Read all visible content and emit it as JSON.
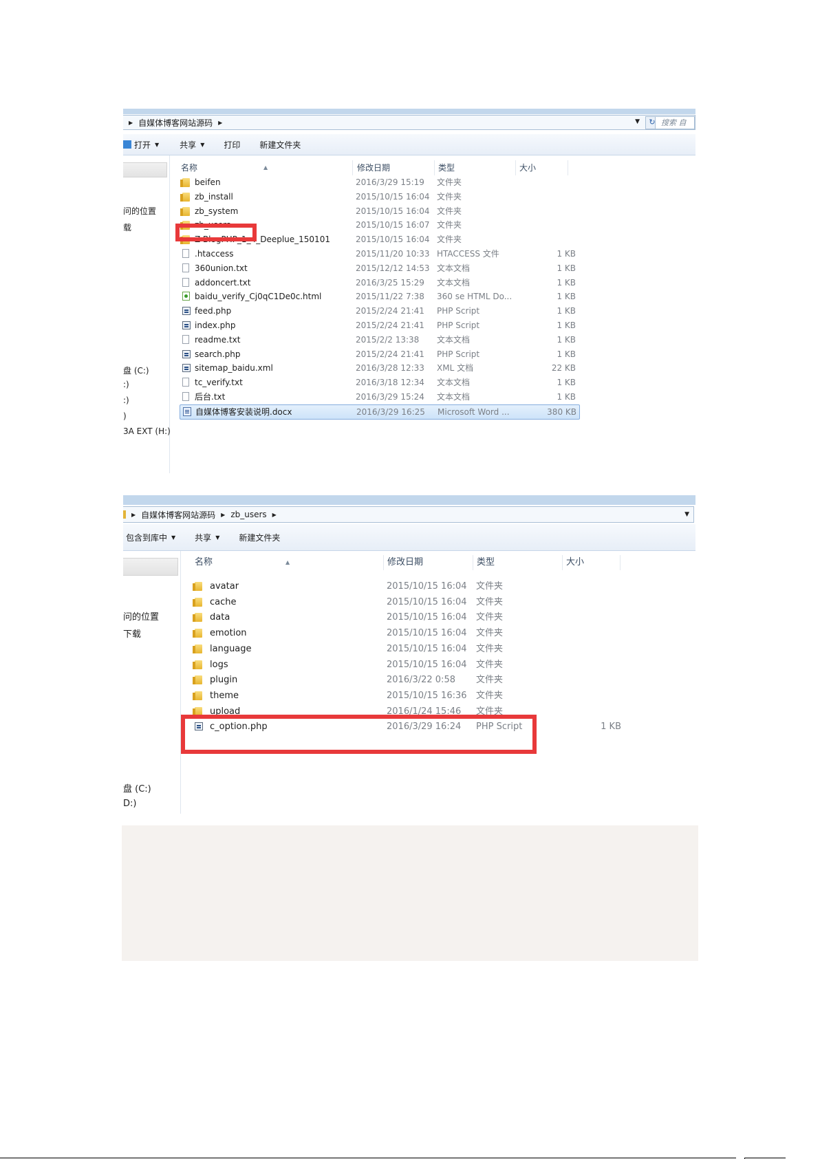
{
  "top": {
    "breadcrumb": "自媒体博客网站源码",
    "search_placeholder": "搜索 自",
    "toolbar": [
      "打开",
      "共享",
      "打印",
      "新建文件夹"
    ],
    "nav": [
      "问的位置",
      "载",
      "盘 (C:)",
      ":)",
      ":)",
      ")",
      "3A EXT (H:)"
    ],
    "columns": {
      "name": "名称",
      "date": "修改日期",
      "type": "类型",
      "size": "大小"
    },
    "files": [
      {
        "icon": "folder-icon",
        "name": "beifen",
        "date": "2016/3/29 15:19",
        "type": "文件夹",
        "size": ""
      },
      {
        "icon": "folder-icon",
        "name": "zb_install",
        "date": "2015/10/15 16:04",
        "type": "文件夹",
        "size": ""
      },
      {
        "icon": "folder-icon",
        "name": "zb_system",
        "date": "2015/10/15 16:04",
        "type": "文件夹",
        "size": ""
      },
      {
        "icon": "folder-icon",
        "name": "zb_users",
        "date": "2015/10/15 16:07",
        "type": "文件夹",
        "size": ""
      },
      {
        "icon": "folder-icon",
        "name": "Z-BlogPHP_1_4_Deeplue_150101",
        "date": "2015/10/15 16:04",
        "type": "文件夹",
        "size": ""
      },
      {
        "icon": "file-icon",
        "name": ".htaccess",
        "date": "2015/11/20 10:33",
        "type": "HTACCESS 文件",
        "size": "1 KB"
      },
      {
        "icon": "file-icon",
        "name": "360union.txt",
        "date": "2015/12/12 14:53",
        "type": "文本文档",
        "size": "1 KB"
      },
      {
        "icon": "file-icon",
        "name": "addoncert.txt",
        "date": "2016/3/25 15:29",
        "type": "文本文档",
        "size": "1 KB"
      },
      {
        "icon": "html-icon",
        "name": "baidu_verify_Cj0qC1De0c.html",
        "date": "2015/11/22 7:38",
        "type": "360 se HTML Do...",
        "size": "1 KB"
      },
      {
        "icon": "php-icon",
        "name": "feed.php",
        "date": "2015/2/24 21:41",
        "type": "PHP Script",
        "size": "1 KB"
      },
      {
        "icon": "php-icon",
        "name": "index.php",
        "date": "2015/2/24 21:41",
        "type": "PHP Script",
        "size": "1 KB"
      },
      {
        "icon": "file-icon",
        "name": "readme.txt",
        "date": "2015/2/2 13:38",
        "type": "文本文档",
        "size": "1 KB"
      },
      {
        "icon": "php-icon",
        "name": "search.php",
        "date": "2015/2/24 21:41",
        "type": "PHP Script",
        "size": "1 KB"
      },
      {
        "icon": "php-icon",
        "name": "sitemap_baidu.xml",
        "date": "2016/3/28 12:33",
        "type": "XML 文档",
        "size": "22 KB"
      },
      {
        "icon": "file-icon",
        "name": "tc_verify.txt",
        "date": "2016/3/18 12:34",
        "type": "文本文档",
        "size": "1 KB"
      },
      {
        "icon": "file-icon",
        "name": "后台.txt",
        "date": "2016/3/29 15:24",
        "type": "文本文档",
        "size": "1 KB"
      },
      {
        "icon": "word-icon",
        "name": "自媒体博客安装说明.docx",
        "date": "2016/3/29 16:25",
        "type": "Microsoft Word ...",
        "size": "380 KB",
        "selected": true
      }
    ]
  },
  "bottom": {
    "breadcrumb": [
      "自媒体博客网站源码",
      "zb_users"
    ],
    "toolbar": [
      "包含到库中",
      "共享",
      "新建文件夹"
    ],
    "nav": [
      "问的位置",
      "下载",
      "盘 (C:)",
      "D:)"
    ],
    "columns": {
      "name": "名称",
      "date": "修改日期",
      "type": "类型",
      "size": "大小"
    },
    "files": [
      {
        "icon": "folder-icon",
        "name": "avatar",
        "date": "2015/10/15 16:04",
        "type": "文件夹",
        "size": ""
      },
      {
        "icon": "folder-icon",
        "name": "cache",
        "date": "2015/10/15 16:04",
        "type": "文件夹",
        "size": ""
      },
      {
        "icon": "folder-icon",
        "name": "data",
        "date": "2015/10/15 16:04",
        "type": "文件夹",
        "size": ""
      },
      {
        "icon": "folder-icon",
        "name": "emotion",
        "date": "2015/10/15 16:04",
        "type": "文件夹",
        "size": ""
      },
      {
        "icon": "folder-icon",
        "name": "language",
        "date": "2015/10/15 16:04",
        "type": "文件夹",
        "size": ""
      },
      {
        "icon": "folder-icon",
        "name": "logs",
        "date": "2015/10/15 16:04",
        "type": "文件夹",
        "size": ""
      },
      {
        "icon": "folder-icon",
        "name": "plugin",
        "date": "2016/3/22 0:58",
        "type": "文件夹",
        "size": ""
      },
      {
        "icon": "folder-icon",
        "name": "theme",
        "date": "2015/10/15 16:36",
        "type": "文件夹",
        "size": ""
      },
      {
        "icon": "folder-icon",
        "name": "upload",
        "date": "2016/1/24 15:46",
        "type": "文件夹",
        "size": ""
      },
      {
        "icon": "php-icon",
        "name": "c_option.php",
        "date": "2016/3/29 16:24",
        "type": "PHP Script",
        "size": "1 KB"
      }
    ]
  },
  "colors": {
    "highlight": "#e8393a",
    "accent": "#3a86d6"
  }
}
